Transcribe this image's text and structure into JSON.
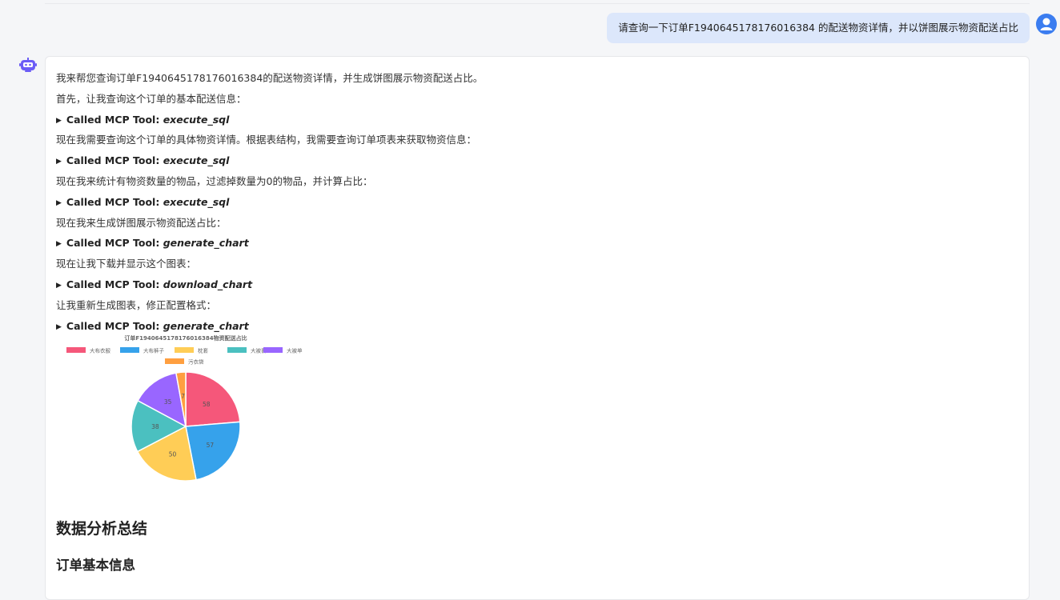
{
  "user_message": {
    "text": "请查询一下订单F1940645178176016384 的配送物资详情，并以饼图展示物资配送占比"
  },
  "bot_message": {
    "lines": [
      {
        "kind": "text",
        "text": "我来帮您查询订单F1940645178176016384的配送物资详情，并生成饼图展示物资配送占比。"
      },
      {
        "kind": "text",
        "text": "首先，让我查询这个订单的基本配送信息："
      },
      {
        "kind": "tool",
        "prefix": "Called MCP Tool: ",
        "name": "execute_sql"
      },
      {
        "kind": "text",
        "text": "现在我需要查询这个订单的具体物资详情。根据表结构，我需要查询订单项表来获取物资信息："
      },
      {
        "kind": "tool",
        "prefix": "Called MCP Tool: ",
        "name": "execute_sql"
      },
      {
        "kind": "text",
        "text": "现在我来统计有物资数量的物品，过滤掉数量为0的物品，并计算占比："
      },
      {
        "kind": "tool",
        "prefix": "Called MCP Tool: ",
        "name": "execute_sql"
      },
      {
        "kind": "text",
        "text": "现在我来生成饼图展示物资配送占比："
      },
      {
        "kind": "tool",
        "prefix": "Called MCP Tool: ",
        "name": "generate_chart"
      },
      {
        "kind": "text",
        "text": "现在让我下载并显示这个图表："
      },
      {
        "kind": "tool",
        "prefix": "Called MCP Tool: ",
        "name": "download_chart"
      },
      {
        "kind": "text",
        "text": "让我重新生成图表，修正配置格式："
      },
      {
        "kind": "tool",
        "prefix": "Called MCP Tool: ",
        "name": "generate_chart"
      }
    ],
    "section_title": "数据分析总结",
    "subsection_title": "订单基本信息"
  },
  "chart_data": {
    "type": "pie",
    "title": "订单F1940645178176016384物资配送占比",
    "legend_position": "top",
    "categories": [
      "大布衣服",
      "大布裤子",
      "枕套",
      "大被套",
      "大被单",
      "污衣袋"
    ],
    "values": [
      58,
      57,
      50,
      38,
      35,
      7
    ],
    "colors": [
      "#f5577a",
      "#36a2eb",
      "#ffcd56",
      "#4bc0c0",
      "#9966ff",
      "#ff9f40"
    ]
  },
  "icons": {
    "user_avatar": "user-avatar-icon",
    "bot_avatar": "robot-icon",
    "expand": "triangle-right-icon"
  }
}
